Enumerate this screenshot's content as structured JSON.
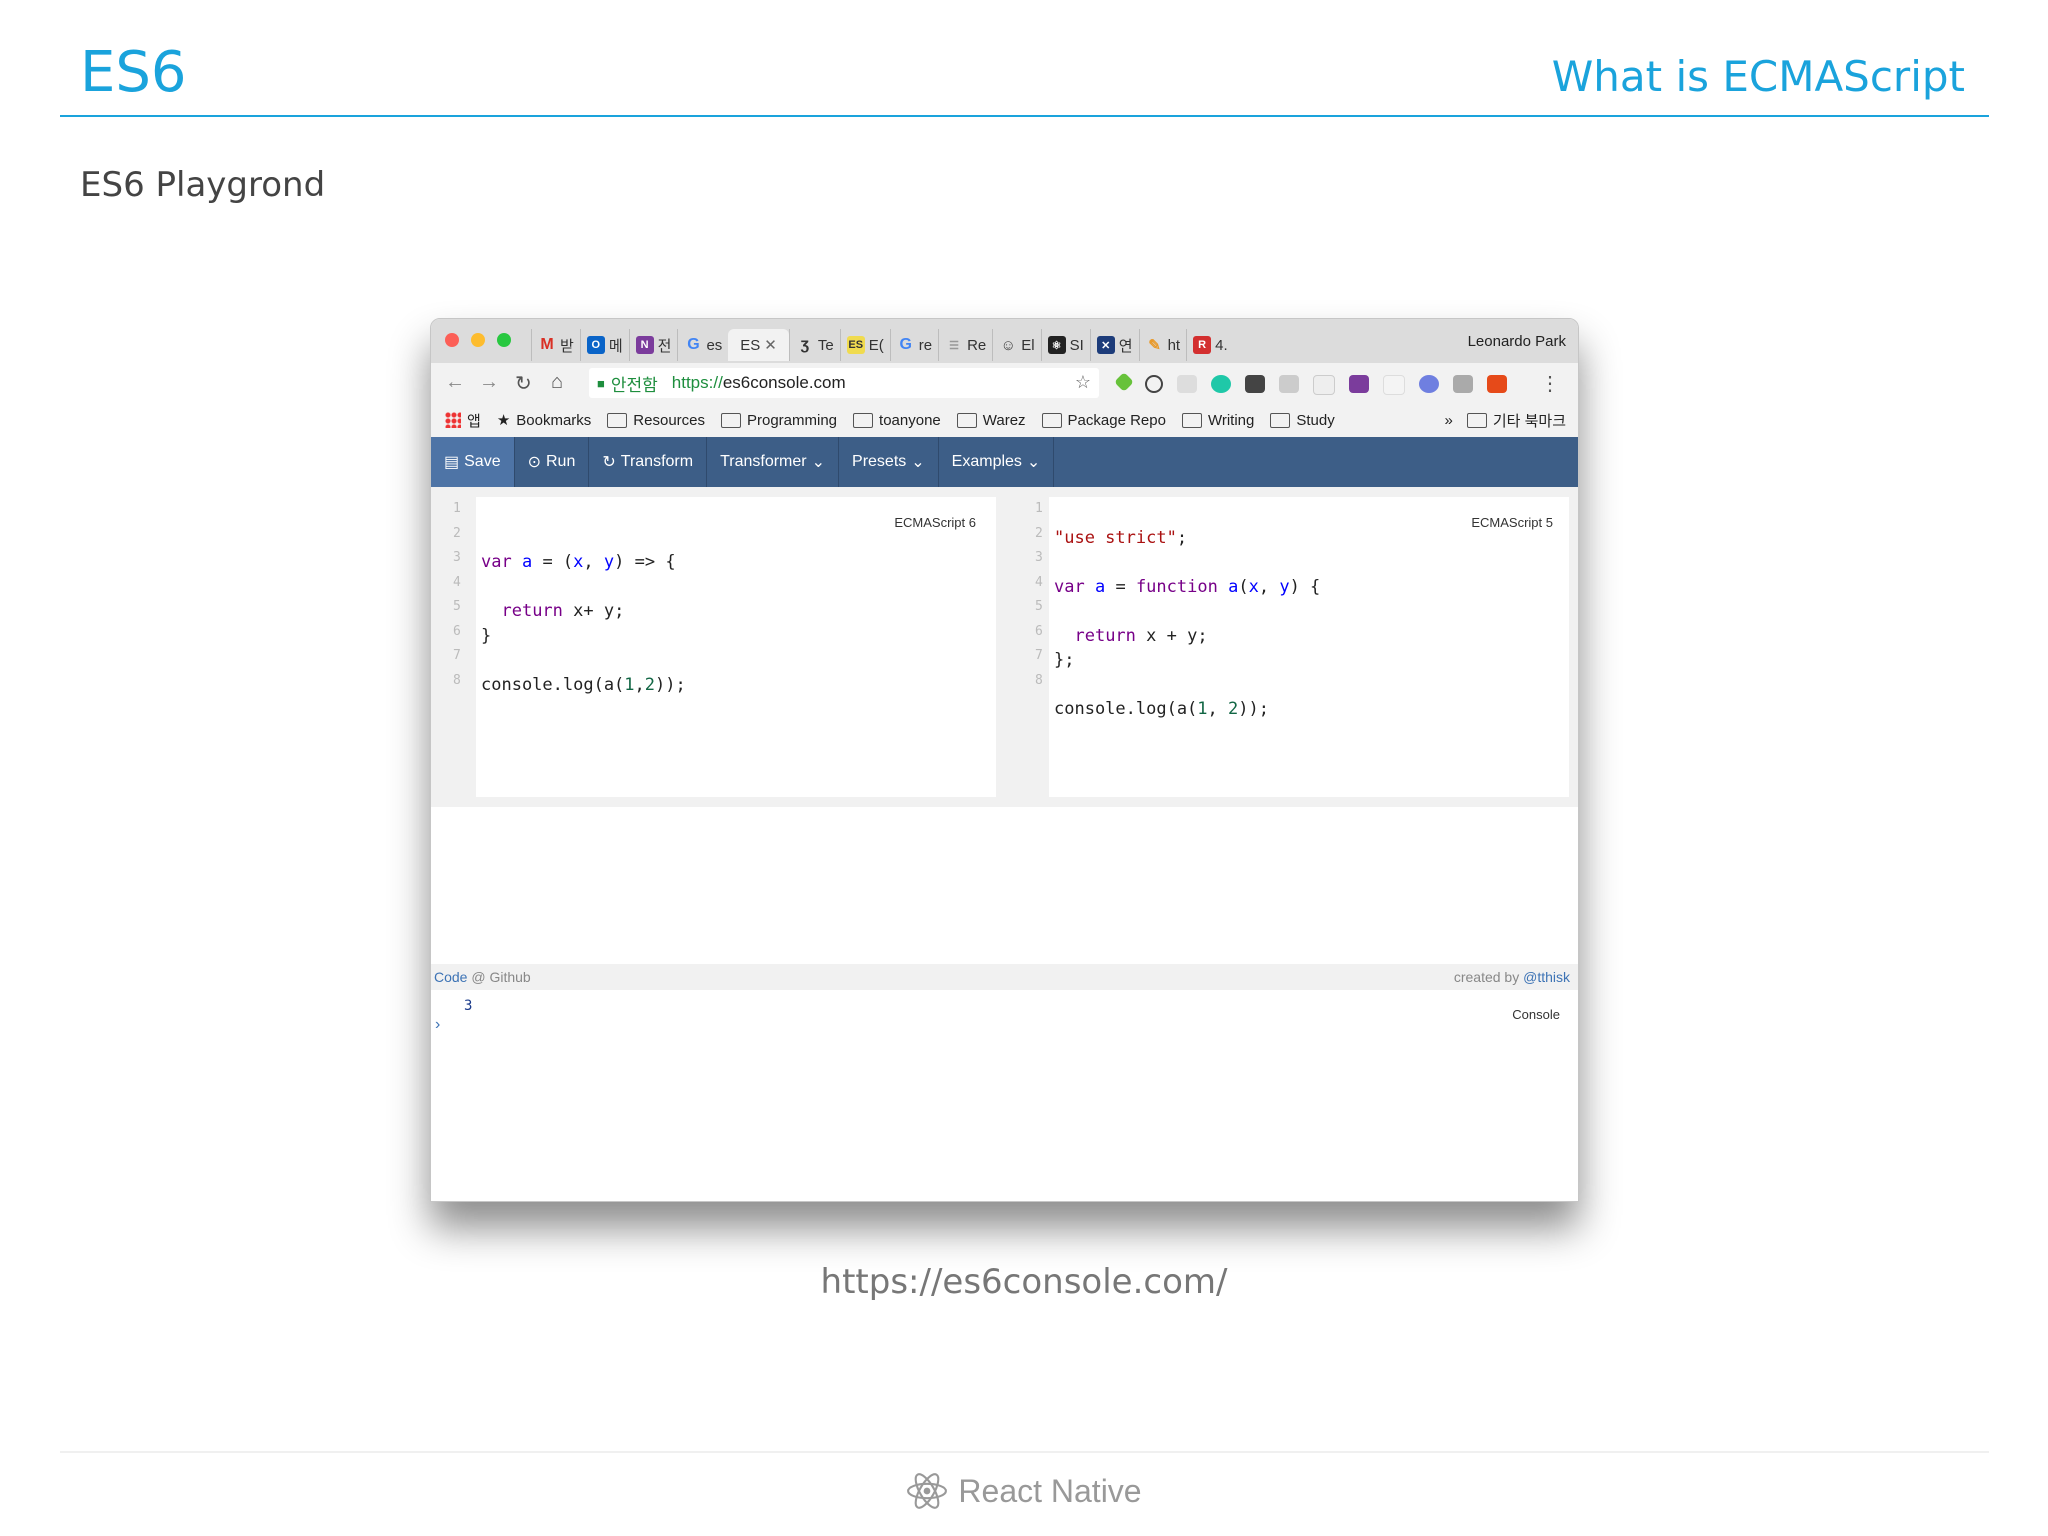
{
  "slide": {
    "title": "ES6",
    "section": "What is ECMAScript",
    "subtitle": "ES6 Playgrond",
    "url_caption": "https://es6console.com/",
    "footer": "React Native"
  },
  "browser": {
    "tabs": [
      {
        "label": "받",
        "icon": "gmail-icon"
      },
      {
        "label": "메",
        "icon": "outlook-icon"
      },
      {
        "label": "전",
        "icon": "onenote-icon"
      },
      {
        "label": "es",
        "icon": "google-icon"
      },
      {
        "label": "ES",
        "icon": "none",
        "active": true
      },
      {
        "label": "Te",
        "icon": "script-icon"
      },
      {
        "label": "E(",
        "icon": "es-icon"
      },
      {
        "label": "re",
        "icon": "google-icon"
      },
      {
        "label": "Re",
        "icon": "page-icon"
      },
      {
        "label": "El",
        "icon": "person-icon"
      },
      {
        "label": "SI",
        "icon": "react-icon"
      },
      {
        "label": "연",
        "icon": "x-icon"
      },
      {
        "label": "ht",
        "icon": "pen-icon"
      },
      {
        "label": "4.",
        "icon": "pdf-icon"
      }
    ],
    "profile_name": "Leonardo Park",
    "secure_label": "안전함",
    "url_scheme": "https://",
    "url_host": "es6console.com",
    "bookmarks": {
      "apps_label": "앱",
      "items": [
        "Bookmarks",
        "Resources",
        "Programming",
        "toanyone",
        "Warez",
        "Package Repo",
        "Writing",
        "Study"
      ],
      "more": "»",
      "other": "기타 북마크"
    }
  },
  "app": {
    "toolbar": {
      "save": "Save",
      "run": "Run",
      "transform": "Transform",
      "transformer": "Transformer",
      "presets": "Presets",
      "examples": "Examples"
    },
    "left_editor": {
      "label": "ECMAScript 6",
      "line_numbers": [
        "1",
        "2",
        "3",
        "4",
        "5",
        "6",
        "7",
        "8"
      ]
    },
    "right_editor": {
      "label": "ECMAScript 5",
      "line_numbers": [
        "1",
        "2",
        "3",
        "4",
        "5",
        "6",
        "7",
        "8"
      ]
    },
    "codebar": {
      "code_link": "Code",
      "at_github": " @ Github",
      "created_by": "created by ",
      "author": "@tthisk"
    },
    "console": {
      "output": "3",
      "prompt": "›",
      "label": "Console"
    }
  },
  "colors": {
    "accent": "#1aa3dc",
    "app_toolbar": "#3d5e87"
  }
}
